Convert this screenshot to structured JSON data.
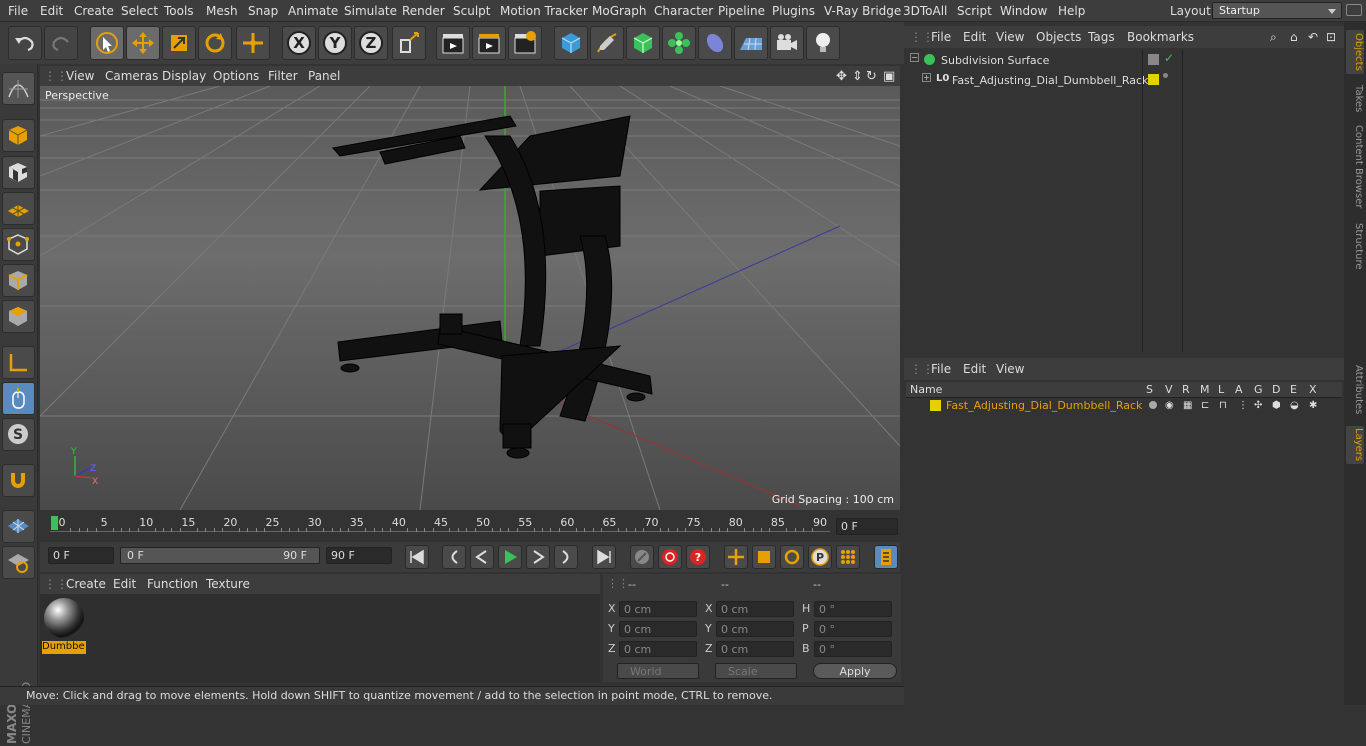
{
  "menubar": {
    "items": [
      "File",
      "Edit",
      "Create",
      "Select",
      "Tools",
      "Mesh",
      "Snap",
      "Animate",
      "Simulate",
      "Render",
      "Sculpt",
      "Motion Tracker",
      "MoGraph",
      "Character",
      "Pipeline",
      "Plugins",
      "V-Ray Bridge",
      "3DToAll",
      "Script",
      "Window",
      "Help"
    ],
    "layout_label": "Layout:",
    "layout_value": "Startup"
  },
  "viewport": {
    "menu": [
      "View",
      "Cameras",
      "Display",
      "Options",
      "Filter",
      "Panel"
    ],
    "camera_label": "Perspective",
    "grid_spacing": "Grid Spacing : 100 cm"
  },
  "timeline": {
    "ticks": [
      "0",
      "5",
      "10",
      "15",
      "20",
      "25",
      "30",
      "35",
      "40",
      "45",
      "50",
      "55",
      "60",
      "65",
      "70",
      "75",
      "80",
      "85",
      "90"
    ],
    "current_frame": "0 F"
  },
  "playback": {
    "start": "0 F",
    "range_start": "0 F",
    "range_end": "90 F",
    "end": "90 F"
  },
  "material_panel": {
    "menu": [
      "Create",
      "Edit",
      "Function",
      "Texture"
    ],
    "material_name": "Dumbbe"
  },
  "coords": {
    "headers": [
      "--",
      "--",
      "--"
    ],
    "rows": [
      {
        "a": "X",
        "av": "0 cm",
        "b": "X",
        "bv": "0 cm",
        "c": "H",
        "cv": "0 °"
      },
      {
        "a": "Y",
        "av": "0 cm",
        "b": "Y",
        "bv": "0 cm",
        "c": "P",
        "cv": "0 °"
      },
      {
        "a": "Z",
        "av": "0 cm",
        "b": "Z",
        "bv": "0 cm",
        "c": "B",
        "cv": "0 °"
      }
    ],
    "space": "World",
    "mode": "Scale",
    "apply": "Apply"
  },
  "objects_panel": {
    "menu": [
      "File",
      "Edit",
      "View",
      "Objects",
      "Tags",
      "Bookmarks"
    ],
    "items": [
      "Subdivision Surface",
      "Fast_Adjusting_Dial_Dumbbell_Rack"
    ]
  },
  "layers_panel": {
    "menu": [
      "File",
      "Edit",
      "View"
    ],
    "columns": [
      "Name",
      "S",
      "V",
      "R",
      "M",
      "L",
      "A",
      "G",
      "D",
      "E",
      "X"
    ],
    "layer_name": "Fast_Adjusting_Dial_Dumbbell_Rack"
  },
  "side_tabs": [
    "Objects",
    "Takes",
    "Content Browser",
    "Structure",
    "Attributes",
    "Layers"
  ],
  "status": "Move: Click and drag to move elements. Hold down SHIFT to quantize movement / add to the selection in point mode, CTRL to remove.",
  "colors": {
    "accent": "#e8a000",
    "layer": "#e8d000"
  }
}
